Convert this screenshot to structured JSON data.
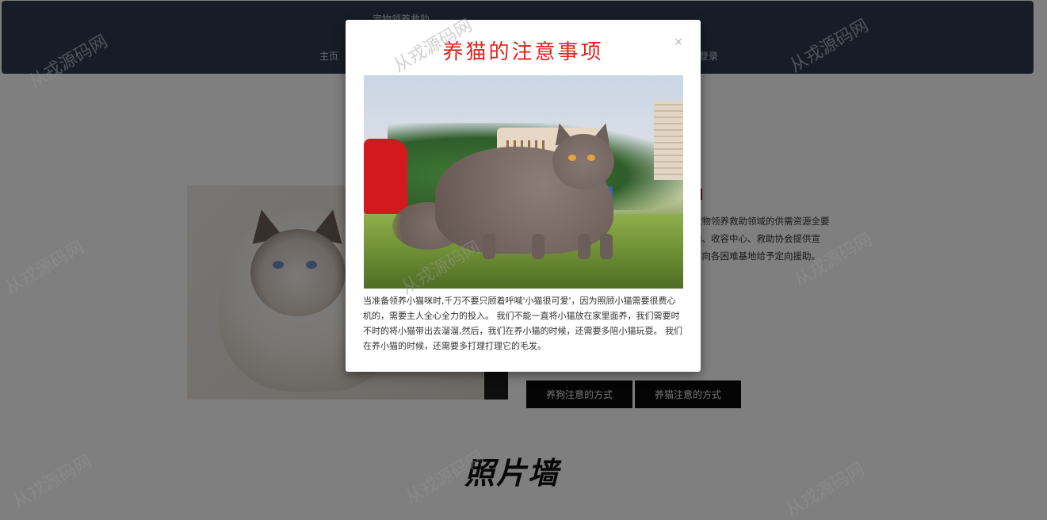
{
  "navbar": {
    "brand": "宠物领养救助",
    "home": "主页",
    "login": "/登录"
  },
  "about": {
    "lines": [
      "宠物领养救助领域的供需资源全要",
      "地、收容中心、救助协会提供宣",
      "再向各困难基地给予定向援助。"
    ]
  },
  "buttons": {
    "dog": "养狗注意的方式",
    "cat": "养猫注意的方式"
  },
  "photo_wall": {
    "title": "照片墙"
  },
  "modal": {
    "title": "养猫的注意事项",
    "close": "×",
    "paragraph": "当准备领养小猫咪时,千万不要只顾着呼喊'小猫很可爱'，因为照顾小猫需要很费心机的，需要主人全心全力的投入。 我们不能一直将小猫放在家里面养，我们需要时不时的将小猫带出去溜溜,然后，我们在养小猫的时候，还需要多陪小猫玩耍。 我们在养小猫的时候，还需要多打理打理它的毛发。"
  },
  "watermark": {
    "text": "从戎源码网"
  },
  "colors": {
    "navbar": "#2e3a4e",
    "title_red": "#e0231f",
    "button_bg": "#0a0a0a"
  }
}
